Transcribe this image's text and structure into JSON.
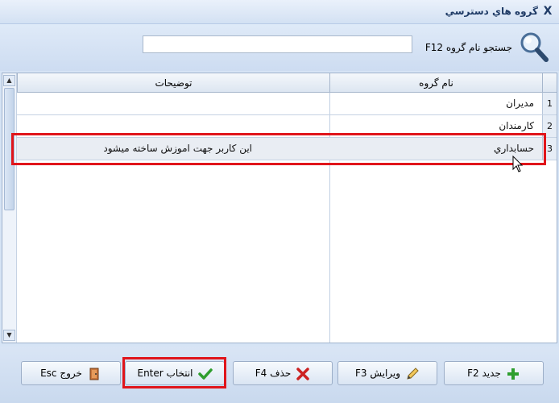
{
  "window": {
    "title": "گروه هاي دسترسي",
    "close_glyph": "X"
  },
  "search": {
    "label": "جستجو  نام گروه F12",
    "value": "",
    "placeholder": ""
  },
  "grid": {
    "columns": {
      "description": "توضيحات",
      "name": "نام گروه"
    },
    "rows": [
      {
        "num": "1",
        "name": "مديران",
        "description": ""
      },
      {
        "num": "2",
        "name": "کارمندان",
        "description": ""
      },
      {
        "num": "3",
        "name": "حسابداري",
        "description": "اين کاربر جهت اموزش ساخته ميشود"
      }
    ],
    "selected_row": 3
  },
  "footer": {
    "new_label": "جديد F2",
    "edit_label": "ويرايش F3",
    "delete_label": "حذف F4",
    "select_label": "انتخاب Enter",
    "exit_label": "خروج Esc"
  },
  "icons": {
    "new": "plus-icon",
    "edit": "pencil-icon",
    "delete": "x-icon",
    "select": "check-icon",
    "exit": "door-icon",
    "search": "magnifier-icon"
  },
  "colors": {
    "highlight": "#e0151b",
    "accent": "#1f3b66",
    "new_icon": "#2e9e2e",
    "delete_icon": "#cc2222",
    "check_icon": "#2e9e2e"
  }
}
